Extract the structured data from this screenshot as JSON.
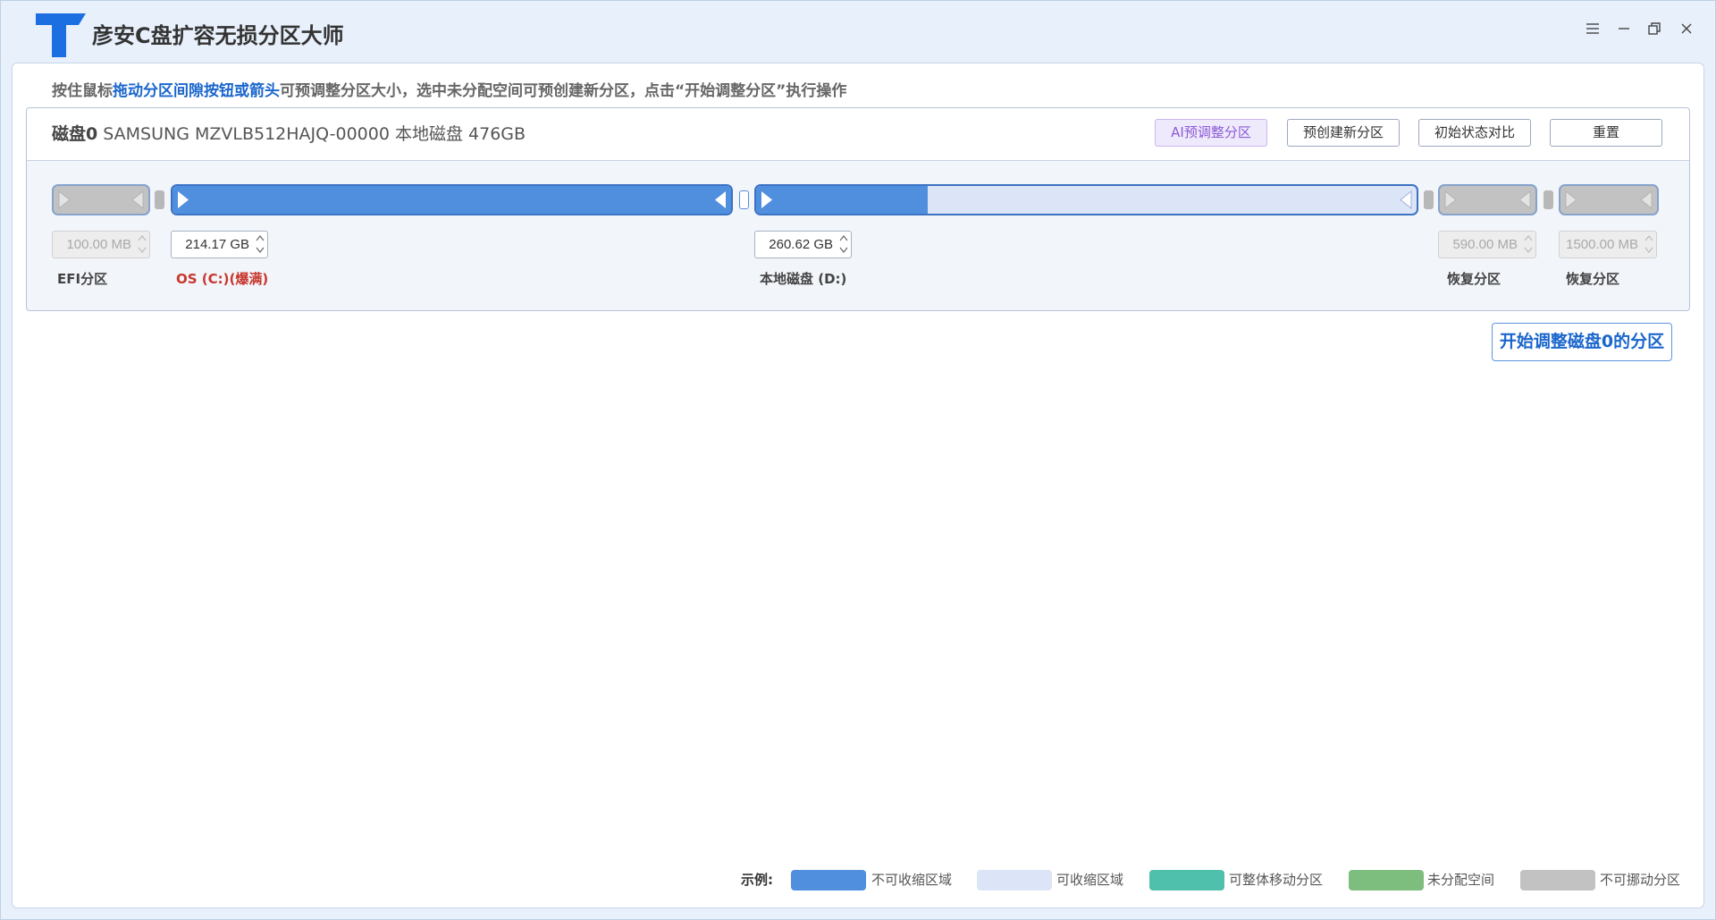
{
  "app": {
    "title": "彦安C盘扩容无损分区大师",
    "logo_icon": "logo-t-icon"
  },
  "window_controls": {
    "menu_icon": "hamburger-icon",
    "minimize_icon": "minimize-icon",
    "restore_icon": "restore-icon",
    "close_icon": "close-icon"
  },
  "instruction": {
    "prefix": "按住鼠标",
    "highlight": "拖动分区间隙按钮或箭头",
    "suffix": "可预调整分区大小，选中未分配空间可预创建新分区，点击“开始调整分区”执行操作"
  },
  "disk": {
    "name": "磁盘0",
    "details": "SAMSUNG MZVLB512HAJQ-00000 本地磁盘 476GB",
    "actions": {
      "ai_adjust": "AI预调整分区",
      "pre_create": "预创建新分区",
      "compare_initial": "初始状态对比",
      "reset": "重置"
    },
    "partitions": [
      {
        "label": "EFI分区",
        "size": "100.00 MB",
        "editable": false
      },
      {
        "label": "OS (C:)(爆满)",
        "size": "214.17 GB",
        "editable": true,
        "non_shrinkable_fraction": 1.0
      },
      {
        "label": "本地磁盘 (D:)",
        "size": "260.62 GB",
        "editable": true,
        "non_shrinkable_fraction": 0.26
      },
      {
        "label": "恢复分区",
        "size": "590.00 MB",
        "editable": false
      },
      {
        "label": "恢复分区",
        "size": "1500.00 MB",
        "editable": false
      }
    ]
  },
  "start_button": "开始调整磁盘0的分区",
  "legend": {
    "title": "示例:",
    "items": [
      {
        "label": "不可收缩区域",
        "color": "#4f8fde"
      },
      {
        "label": "可收缩区域",
        "color": "#dce4f7"
      },
      {
        "label": "可整体移动分区",
        "color": "#4fc0ab"
      },
      {
        "label": "未分配空间",
        "color": "#7dbd7d"
      },
      {
        "label": "不可挪动分区",
        "color": "#c2c2c2"
      }
    ]
  },
  "colors": {
    "accent": "#1a66cc",
    "warning": "#c8372d",
    "logo": "#1b6fe0"
  }
}
